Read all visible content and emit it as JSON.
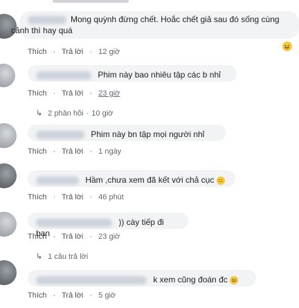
{
  "comments": [
    {
      "text_line1": "Mong quỳnh đừng chết. Hoắc chết giả sau đó sống cùng",
      "text_line2": "cảnh thì hay quá",
      "like": "Thích",
      "reply": "Trả lời",
      "time": "12 giờ",
      "reaction": "😆"
    },
    {
      "text": "Phim này bao nhiêu tập các b nhỉ",
      "like": "Thích",
      "reply": "Trả lời",
      "time": "23 giờ",
      "replies_label": "2 phản hồi",
      "replies_time": "10 giờ"
    },
    {
      "text": "Phim này bn tập mọi người nhỉ",
      "like": "Thích",
      "reply": "Trả lời",
      "time": "1 ngày"
    },
    {
      "text": "Hầm ,chưa xem đã kết với chả cục",
      "emoji": "😊",
      "like": "Thích",
      "reply": "Trả lời",
      "time": "46 phút"
    },
    {
      "text": ")) cày tiếp đi bạn",
      "like": "Thích",
      "reply": "Trả lời",
      "time": "23 giờ",
      "replies_label": "1 câu trả lời"
    },
    {
      "text": "k xem cũng đoán đc",
      "emoji": "😆",
      "like": "Thích",
      "reply": "Trả lời",
      "time": "5 giờ"
    }
  ]
}
